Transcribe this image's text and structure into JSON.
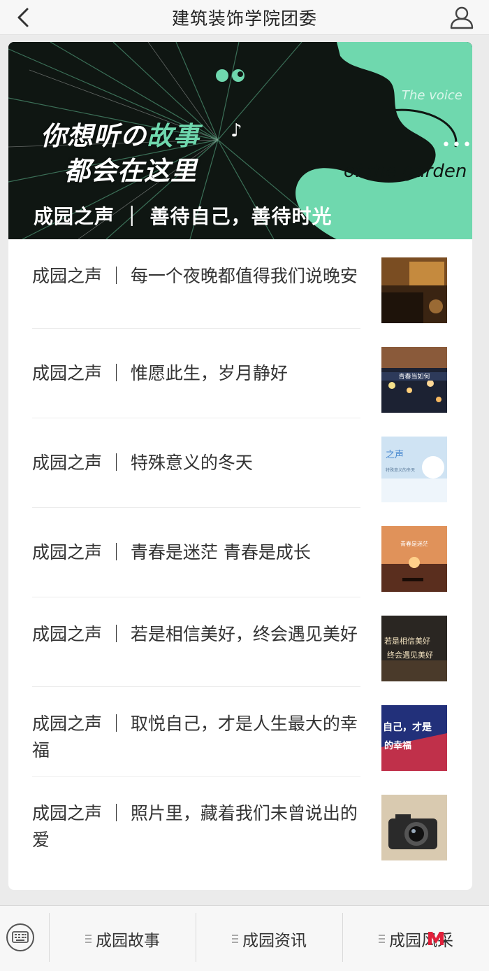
{
  "header": {
    "title": "建筑装饰学院团委",
    "back_icon": "chevron-left-icon",
    "profile_icon": "user-icon"
  },
  "banner": {
    "headline_pre": "你想听の",
    "headline_highlight": "故事",
    "headline_line2": "都会在这里",
    "note_symbol": "♪",
    "english_line1": "The voice",
    "english_line2": "of the garden",
    "dots": "•••",
    "caption": "成园之声 ｜ 善待自己，善待时光",
    "accent_color": "#6fd8ae"
  },
  "articles": [
    {
      "title": "成园之声 ｜ 每一个夜晚都值得我们说晚安"
    },
    {
      "title": "成园之声 ｜ 惟愿此生，岁月静好"
    },
    {
      "title": "成园之声 ｜ 特殊意义的冬天"
    },
    {
      "title": "成园之声 ｜ 青春是迷茫 青春是成长"
    },
    {
      "title": "成园之声 ｜ 若是相信美好，终会遇见美好"
    },
    {
      "title": "成园之声 ｜ 取悦自己，才是人生最大的幸福"
    },
    {
      "title": "成园之声 ｜ 照片里，藏着我们未曾说出的爱"
    }
  ],
  "thumb_text": {
    "t2": "青春当如何",
    "t3_a": "之声",
    "t3_b": "特殊意义的冬天",
    "t4": "青春是迷茫",
    "t5_a": "若是相信美好",
    "t5_b": "终会遇见美好",
    "t6_a": "自己，才是",
    "t6_b": "的幸福"
  },
  "tabbar": {
    "keyboard_icon": "keyboard-icon",
    "tabs": [
      "成园故事",
      "成园资讯",
      "成园风采"
    ]
  }
}
